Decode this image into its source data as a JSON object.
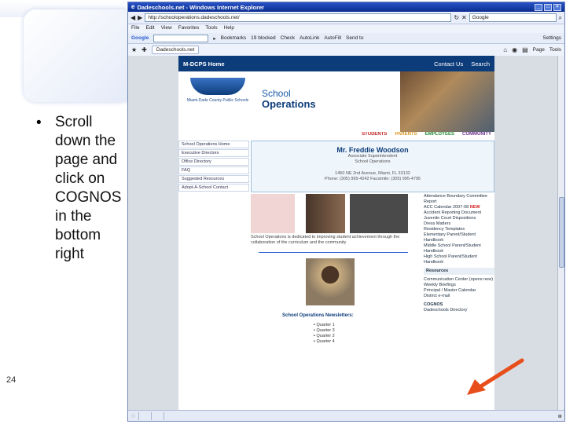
{
  "slide": {
    "bullet_char": "•",
    "bullet_text": "Scroll down the page and click on COGNOS in the bottom right",
    "page_number": "24"
  },
  "browser": {
    "title": "Dadeschools.net - Windows Internet Explorer",
    "url": "http://schooloperations.dadeschools.net/",
    "search_placeholder": "Google",
    "menus": [
      "File",
      "Edit",
      "View",
      "Favorites",
      "Tools",
      "Help"
    ],
    "google_label": "Google",
    "google_toolbar": [
      "Bookmarks",
      "19 blocked",
      "Check",
      "AutoLink",
      "AutoFill",
      "Send to"
    ],
    "google_settings": "Settings",
    "tab_label": "Dadeschools.net",
    "tab_tools": [
      "Page",
      "Tools"
    ]
  },
  "site": {
    "home_label": "M-DCPS Home",
    "top_links": [
      "Contact Us",
      "Search"
    ],
    "logo_text": "Miami-Dade County Public Schools",
    "dept_line1": "School",
    "dept_line2": "Operations",
    "nav": [
      "STUDENTS",
      "PARENTS",
      "EMPLOYEES",
      "COMMUNITY"
    ],
    "sidebar": [
      "School Operations Home",
      "Executive Directors",
      "Office Directory",
      "FAQ",
      "Suggested Resources",
      "Adopt-A-School Contact"
    ],
    "leader_name": "Mr. Freddie Woodson",
    "leader_title": "Associate Superintendent",
    "leader_dept": "School Operations",
    "address": "1450 NE 2nd Avenue, Miami, FL 33132",
    "phone": "Phone: (305) 995-4242 Facsimile: (305) 995-4795",
    "mission": "School Operations is dedicated to improving student achievement through the collaboration of the curriculum and the community",
    "newsletters_title": "School Operations Newsletters:",
    "newsletters": [
      "Quarter 1",
      "Quarter 3",
      "Quarter 2",
      "Quarter 4"
    ],
    "right_links": [
      "Attendance Boundary Committee Report",
      "ACC Calendar 2007-08",
      "Accident Reporting Document",
      "Juvenile Court Dispositions",
      "Dress Matters",
      "Residency Templates",
      "Elementary Parent/Student Handbook",
      "Middle School Parent/Student Handbook",
      "High School Parent/Student Handbook"
    ],
    "resources_label": "Resources",
    "resource_links": [
      "Communication Center (opens new)",
      "Weekly Briefings",
      "Principal / Master Calendar",
      "District e-mail"
    ],
    "cognos_label": "COGNOS",
    "directory_label": "Dadeschools Directory",
    "new_badge": "NEW"
  },
  "colors": {
    "arrow": "#e84e1b",
    "site_header": "#0d3c7a",
    "titlebar": "#0a2c8f"
  }
}
